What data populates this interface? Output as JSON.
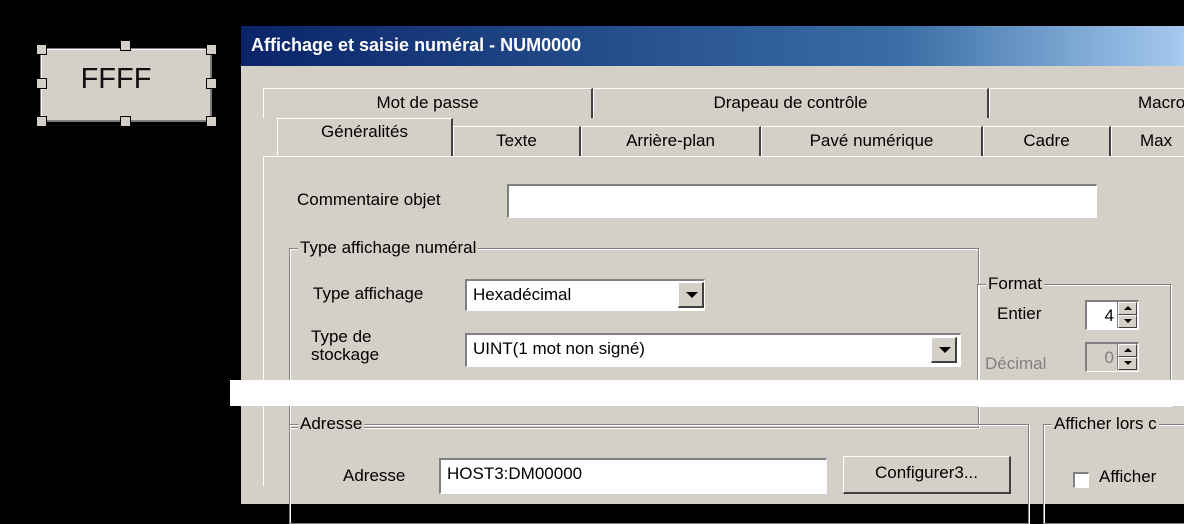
{
  "canvas": {
    "object_label": "FFFF"
  },
  "dialog": {
    "title": "Affichage et saisie numéral  - NUM0000",
    "tabs_back": [
      "Mot de passe",
      "Drapeau de contrôle",
      "Macro"
    ],
    "tabs_front": [
      "Généralités",
      "Texte",
      "Arrière-plan",
      "Pavé numérique",
      "Cadre",
      "Max"
    ],
    "comment_label": "Commentaire objet",
    "comment_value": "",
    "type_group_title": "Type affichage numéral",
    "display_type_label": "Type affichage",
    "display_type_value": "Hexadécimal",
    "storage_type_label_1": "Type de",
    "storage_type_label_2": "stockage",
    "storage_type_value": "UINT(1 mot non signé)",
    "format_group_title": "Format",
    "integer_label": "Entier",
    "integer_value": "4",
    "decimal_label": "Décimal",
    "decimal_value": "0",
    "address_group_title": "Adresse",
    "address_label": "Adresse",
    "address_value": "HOST3:DM00000",
    "configure_button": "Configurer3...",
    "show_group_title": "Afficher lors c",
    "show_checkbox_label": "Afficher"
  }
}
